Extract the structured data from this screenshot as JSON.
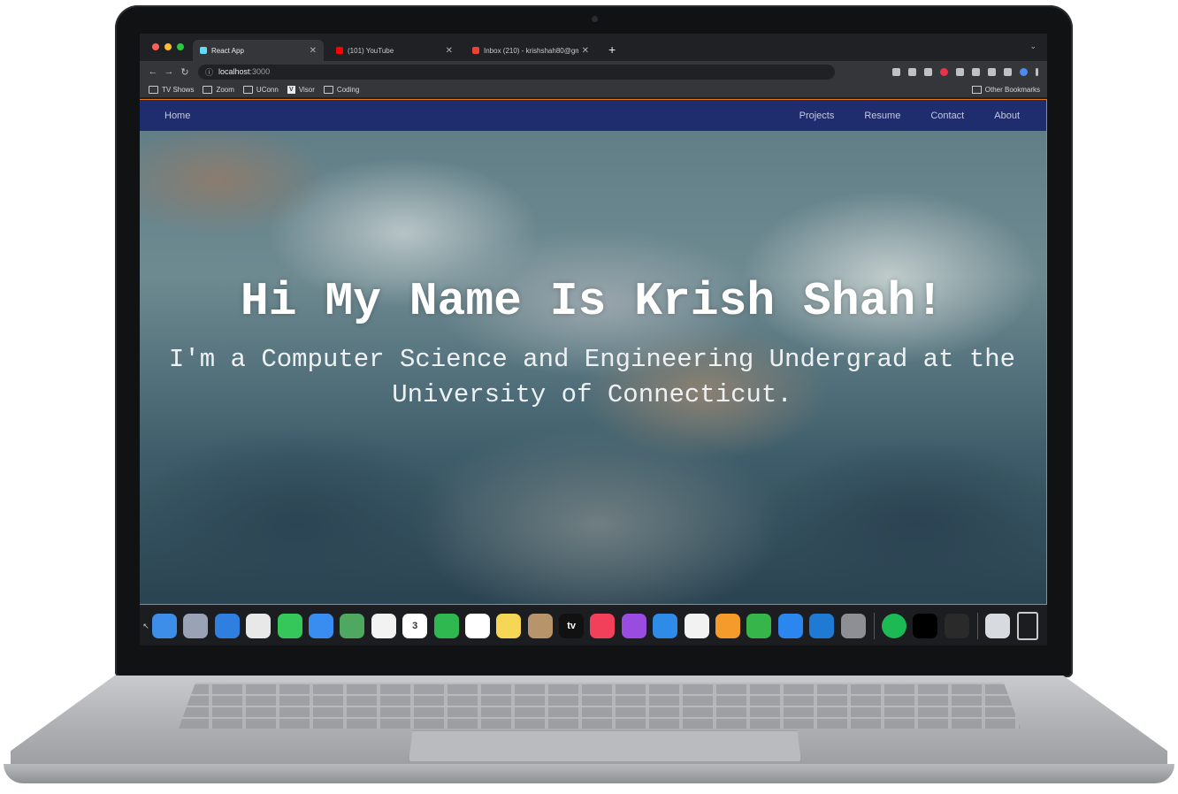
{
  "browser": {
    "tabs": [
      {
        "title": "React App",
        "favicon_color": "#61dafb",
        "active": true
      },
      {
        "title": "(101) YouTube",
        "favicon_color": "#ff0000",
        "active": false
      },
      {
        "title": "Inbox (210) - krishshah80@gm",
        "favicon_color": "#ea4335",
        "active": false
      }
    ],
    "new_tab": "+",
    "url_host": "localhost",
    "url_port": ":3000",
    "bookmarks": [
      "TV Shows",
      "Zoom",
      "UConn",
      "Visor",
      "Coding"
    ],
    "other_bookmarks": "Other Bookmarks"
  },
  "site": {
    "nav_home": "Home",
    "nav_links": [
      "Projects",
      "Resume",
      "Contact",
      "About"
    ],
    "heading": "Hi My Name Is Krish Shah!",
    "subheading": "I'm a Computer Science and Engineering Undergrad at the University of Connecticut."
  },
  "dock": {
    "apps": [
      {
        "name": "finder",
        "color": "#3d8ee8"
      },
      {
        "name": "launchpad",
        "color": "#9aa3b5"
      },
      {
        "name": "safari",
        "color": "#2f7fe0"
      },
      {
        "name": "chrome",
        "color": "#e8e8e8"
      },
      {
        "name": "messages",
        "color": "#35c759"
      },
      {
        "name": "mail",
        "color": "#3a8df0"
      },
      {
        "name": "maps",
        "color": "#4fa860"
      },
      {
        "name": "photos",
        "color": "#f2f2f2"
      },
      {
        "name": "calendar",
        "color": "#ffffff",
        "label": "3"
      },
      {
        "name": "facetime",
        "color": "#2fb84f"
      },
      {
        "name": "reminders",
        "color": "#ffffff"
      },
      {
        "name": "notes",
        "color": "#f6d755"
      },
      {
        "name": "contacts",
        "color": "#b8946a"
      },
      {
        "name": "apple-tv",
        "color": "#111111",
        "label": "tv"
      },
      {
        "name": "music",
        "color": "#f2405a"
      },
      {
        "name": "podcasts",
        "color": "#9a4ce0"
      },
      {
        "name": "keynote",
        "color": "#2f8be8"
      },
      {
        "name": "news",
        "color": "#f2f2f2"
      },
      {
        "name": "pages",
        "color": "#f59b2c"
      },
      {
        "name": "numbers",
        "color": "#36b64a"
      },
      {
        "name": "app-store",
        "color": "#2b86f0"
      },
      {
        "name": "vscode",
        "color": "#1f7ad4"
      },
      {
        "name": "system-preferences",
        "color": "#8d8f94"
      },
      {
        "name": "spotify",
        "color": "#1db954"
      },
      {
        "name": "jetbrains",
        "color": "#000000"
      },
      {
        "name": "terminal",
        "color": "#2a2a2a"
      },
      {
        "name": "finder-window",
        "color": "#d7dbe0"
      },
      {
        "name": "trash",
        "color": "#c9cbcf"
      }
    ]
  }
}
